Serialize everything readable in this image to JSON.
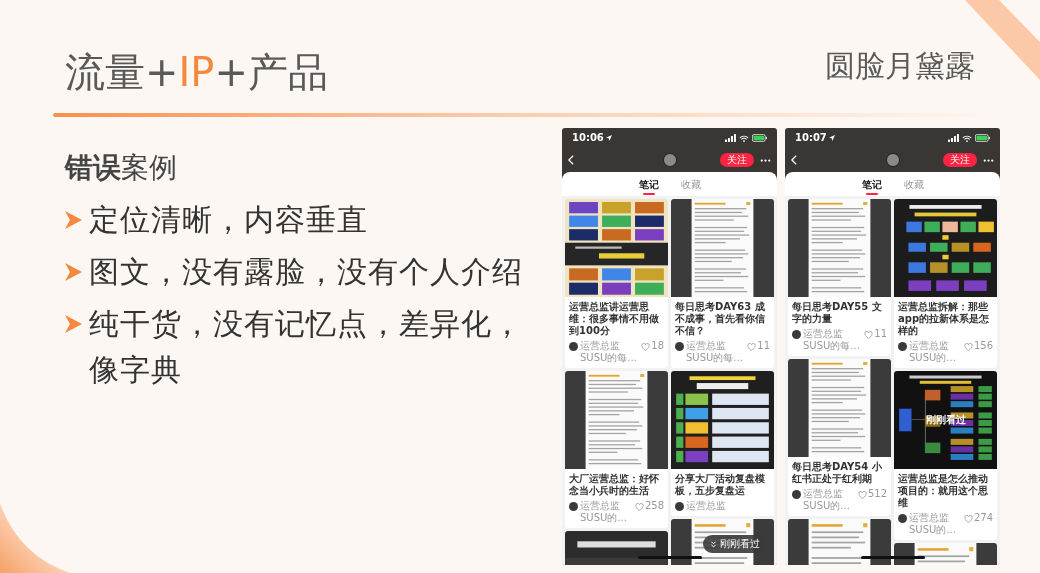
{
  "slide": {
    "title": [
      {
        "text": "流量+",
        "accent": false
      },
      {
        "text": "IP",
        "accent": true
      },
      {
        "text": "+产品",
        "accent": false
      }
    ],
    "author": "圆脸月黛露"
  },
  "content": {
    "heading": "**错误**案例",
    "bullets": [
      "定位清晰，内容垂直",
      "图文，没有露脸，没有个人介绍",
      "纯干货，没有记忆点，差异化，像字典"
    ]
  },
  "phones": [
    {
      "time": "10:06",
      "follow_button": "关注",
      "tabs": [
        {
          "label": "笔记",
          "selected": true
        },
        {
          "label": "收藏",
          "selected": false
        }
      ],
      "columns": [
        [
          {
            "kind": "tile-grid",
            "title": "运营总监讲运营思维：很多事情不用做到100分",
            "author": "运营总监SUSU的每...",
            "likes": "18"
          },
          {
            "kind": "note-screenshot",
            "title": "大厂运营总监：好怀念当小兵时的生活",
            "author": "运营总监SUSU的...",
            "likes": "258"
          },
          {
            "kind": "dark-banner"
          }
        ],
        [
          {
            "kind": "note-screenshot",
            "title": "每日思考DAY63 成不成事，首先看你信不信？",
            "author": "运营总监SUSU的每...",
            "likes": "11"
          },
          {
            "kind": "checklist-chart",
            "title": "分享大厂活动复盘模板，五步复盘运",
            "author": "运营总监"
          },
          {
            "kind": "note-screenshot"
          }
        ]
      ],
      "toast": "刚刚看过"
    },
    {
      "time": "10:07",
      "follow_button": "关注",
      "tabs": [
        {
          "label": "笔记",
          "selected": true
        },
        {
          "label": "收藏",
          "selected": false
        }
      ],
      "columns": [
        [
          {
            "kind": "note-screenshot",
            "title": "每日思考DAY55 文字的力量",
            "author": "运营总监SUSU的每...",
            "likes": "11"
          },
          {
            "kind": "note-screenshot",
            "title": "每日思考DAY54 小红书正处于红利期",
            "author": "运营总监SUSU的...",
            "likes": "512"
          },
          {
            "kind": "note-screenshot"
          }
        ],
        [
          {
            "kind": "flow-chart",
            "title": "运营总监拆解：那些app的拉新体系是怎样的",
            "author": "运营总监SUSU的...",
            "likes": "156"
          },
          {
            "kind": "mind-map",
            "badge": "刚刚看过",
            "title": "运营总监是怎么推动项目的：就用这个思维",
            "author": "运营总监SUSU的...",
            "likes": "274"
          },
          {
            "kind": "note-screenshot"
          }
        ]
      ]
    }
  ]
}
